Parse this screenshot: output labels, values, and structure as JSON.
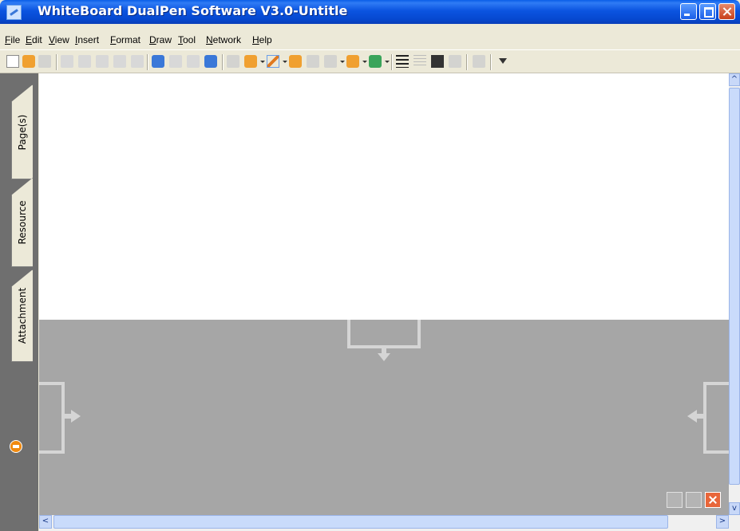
{
  "window": {
    "title": "WhiteBoard DualPen Software V3.0-Untitle"
  },
  "menu": [
    "File",
    "Edit",
    "View",
    "Insert",
    "Format",
    "Draw",
    "Tool",
    "Network",
    "Help"
  ],
  "toolbar": {
    "icons": [
      "new-doc-icon",
      "open-icon",
      "save-icon",
      "copy-icon",
      "paste-icon",
      "delete-icon",
      "undo-icon",
      "redo-icon",
      "insert-page-icon",
      "prev-page-icon",
      "next-page-icon",
      "page-icon",
      "select-icon",
      "eraser-icon",
      "pen-icon",
      "highlighter-icon",
      "brush-icon",
      "line-icon",
      "shape-icon",
      "fill-icon",
      "line-width-icon",
      "line-style-icon",
      "color-icon",
      "transparency-icon",
      "lasso-icon",
      "arrow-down-icon"
    ]
  },
  "side_tabs": [
    "Page(s)",
    "Resource",
    "Attachment"
  ],
  "scroll": {
    "up": "^",
    "down": "v",
    "left": "<",
    "right": ">"
  }
}
